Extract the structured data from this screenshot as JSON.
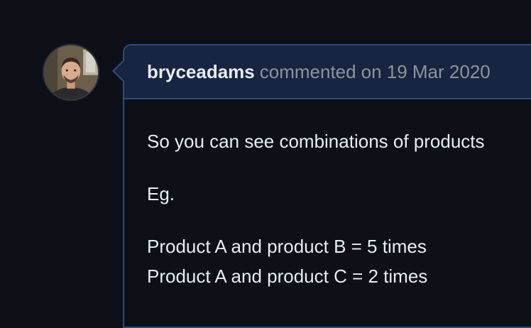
{
  "comment": {
    "author": "bryceadams",
    "action": "commented",
    "timestamp": "on 19 Mar 2020",
    "avatar_icon": "user-avatar",
    "body": {
      "paragraph_1": "So you can see combinations of products",
      "paragraph_2": "Eg.",
      "line_1": "Product A and product B = 5 times",
      "line_2": "Product A and product C = 2 times"
    }
  },
  "colors": {
    "background": "#0d1117",
    "header_background": "#172540",
    "border": "#2f4a78",
    "text_primary": "#e6edf3",
    "text_muted": "#8b949e"
  }
}
